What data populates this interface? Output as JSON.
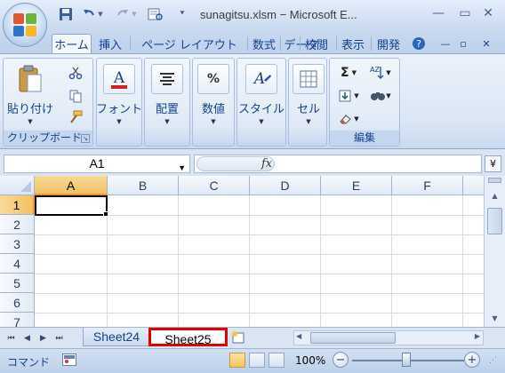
{
  "window": {
    "title": "sunagitsu.xlsm − Microsoft E...",
    "minimize_symbol": "—",
    "maximize_symbol": "▭",
    "close_symbol": "✕"
  },
  "quick_access": {
    "icons": [
      "save-icon",
      "undo-icon",
      "redo-icon",
      "print-preview-icon",
      "customize-dropdown-icon"
    ]
  },
  "tabs": [
    "ホーム",
    "挿入",
    "ページ レイアウト",
    "数式",
    "データ",
    "校閲",
    "表示",
    "開発"
  ],
  "active_tab": "ホーム",
  "tab_controls": {
    "help": "?",
    "minimize": "—",
    "restore": "▫",
    "close": "✕"
  },
  "ribbon": {
    "clipboard": {
      "paste_label": "貼り付け",
      "group_label": "クリップボード",
      "small_icons": [
        "cut-icon",
        "copy-icon",
        "format-painter-icon"
      ]
    },
    "font": {
      "label": "フォント",
      "icon_letter": "A"
    },
    "alignment": {
      "label": "配置",
      "icon_letter": "≡"
    },
    "number": {
      "label": "数値",
      "icon_letter": "%"
    },
    "styles": {
      "label": "スタイル",
      "icon_letter": "A"
    },
    "cells": {
      "label": "セル",
      "icon_letter": "▦"
    },
    "editing": {
      "group_label": "編集",
      "sigma": "Σ",
      "sort_letters": "AZ",
      "find_symbol": "ꔹ"
    }
  },
  "formula_bar": {
    "name_box": "A1",
    "fx_label": "fx",
    "formula": "",
    "expand_symbol": "¥"
  },
  "grid": {
    "columns": [
      "A",
      "B",
      "C",
      "D",
      "E",
      "F"
    ],
    "rows": [
      "1",
      "2",
      "3",
      "4",
      "5",
      "6",
      "7"
    ],
    "active_cell": "A1"
  },
  "sheet_tabs": {
    "nav": [
      "⏮",
      "◀",
      "▶",
      "⏭"
    ],
    "tabs": [
      "Sheet24",
      "Sheet25"
    ],
    "active": "Sheet25",
    "highlight_color": "#e00000"
  },
  "status_bar": {
    "mode": "コマンド",
    "zoom": "100%",
    "zoom_out": "−",
    "zoom_in": "+"
  },
  "colors": {
    "accent": "#15428b",
    "selected_header": "#f1c15f"
  }
}
